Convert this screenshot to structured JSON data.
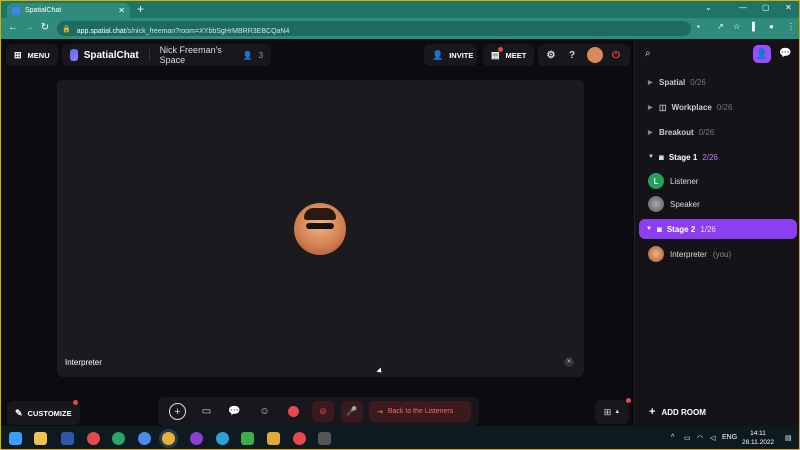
{
  "browser": {
    "tab_title": "SpatialChat",
    "url_host": "app.spatial.chat",
    "url_rest": "/s/nick_freeman?room=XYbbSgHrMBRR3EBCQaN4"
  },
  "header": {
    "menu_label": "MENU",
    "brand": "SpatialChat",
    "space_name": "Nick Freeman's Space",
    "participant_count": "3",
    "invite_label": "INVITE",
    "meet_label": "MEET"
  },
  "stage": {
    "participant_name": "Interpreter"
  },
  "bottom": {
    "customize_label": "CUSTOMIZE",
    "back_label": "Back to the Listeners"
  },
  "sidebar": {
    "rooms": [
      {
        "name": "Spatial",
        "count": "0/26"
      },
      {
        "name": "Workplace",
        "count": "0/26"
      },
      {
        "name": "Breakout",
        "count": "0/26"
      },
      {
        "name": "Stage 1",
        "count": "2/26"
      },
      {
        "name": "Stage 2",
        "count": "1/26"
      }
    ],
    "stage1_members": [
      {
        "name": "Listener",
        "initial": "L"
      },
      {
        "name": "Speaker"
      }
    ],
    "stage2_members": [
      {
        "name": "Interpreter",
        "suffix": "(you)"
      }
    ],
    "add_room_label": "ADD ROOM"
  },
  "taskbar": {
    "lang": "ENG",
    "time": "14:11",
    "date": "28.11.2022"
  },
  "colors": {
    "accent": "#8b3ff0",
    "danger": "#e5484d",
    "chrome": "#2f8b7c"
  }
}
